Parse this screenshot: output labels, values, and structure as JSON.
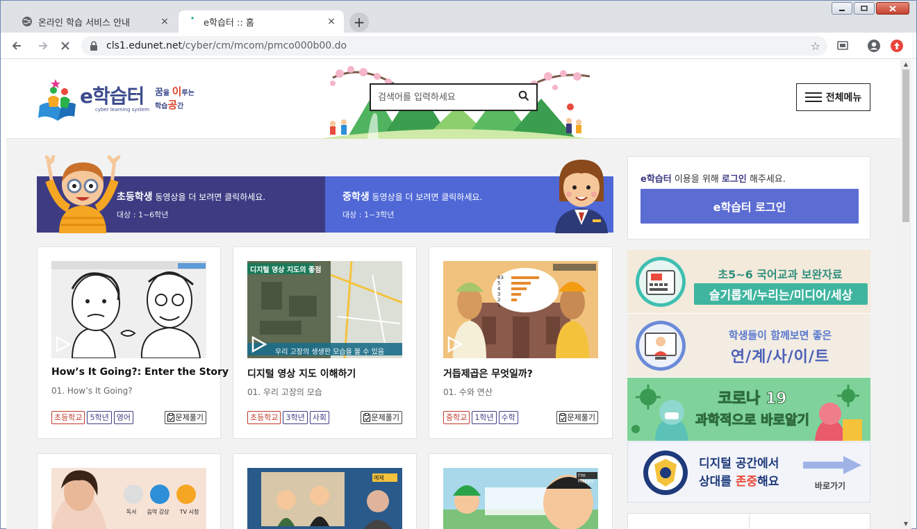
{
  "browser": {
    "tabs": [
      {
        "title": "온라인 학습 서비스 안내",
        "close": "×"
      },
      {
        "title": "e학습터 :: 홈",
        "close": "×"
      }
    ],
    "new_tab": "+",
    "url_host": "cls1.edunet.net",
    "url_path": "/cyber/cm/mcom/pmco000b00.do"
  },
  "header": {
    "logo_main": "e학습터",
    "logo_sub": "cyber learning system",
    "slogan_line1_a": "꿈",
    "slogan_line1_b": "을 ",
    "slogan_line1_c": "이",
    "slogan_line1_d": "루는",
    "slogan_line2_a": "학습",
    "slogan_line2_b": "공",
    "slogan_line2_c": "간",
    "search_placeholder": "검색어를 입력하세요",
    "menu_label": "전체메뉴"
  },
  "banners": [
    {
      "title": "초등학생",
      "title_rest": " 동영상을 더 보려면 클릭하세요.",
      "sub": "대상 : 1~6학년"
    },
    {
      "title": "중학생",
      "title_rest": " 동영상을 더 보려면 클릭하세요.",
      "sub": "대상 : 1~3학년"
    }
  ],
  "login": {
    "msg_a": "e학습터",
    "msg_b": " 이용을 위해 ",
    "msg_c": "로그인",
    "msg_d": " 해주세요.",
    "button": "e학습터 로그인"
  },
  "promos": [
    {
      "line1": "초5~6 국어교과 보완자료",
      "line2": "슬기롭게/누리는/미디어/세상"
    },
    {
      "line1": "학생들이 함께보면 좋은",
      "line2": "연/계/사/이/트"
    },
    {
      "line1": "코로나 19",
      "line2": "과학적으로 바로알기"
    },
    {
      "line1": "디지털 공간에서",
      "line2a": "상대를 ",
      "line2b": "존중",
      "line2c": "해요",
      "link": "바로가기"
    }
  ],
  "cards": [
    {
      "title": "How’s It Going?: Enter the Story",
      "sub": "01. How’s It Going?",
      "school": "초등학교",
      "grade": "5학년",
      "subject": "영어",
      "quiz": "문제풀기",
      "thumb_label": "How's It Going?"
    },
    {
      "title": "디지털 영상 지도 이해하기",
      "sub": "01. 우리 고장의 모습",
      "school": "초등학교",
      "grade": "3학년",
      "subject": "사회",
      "quiz": "문제풀기",
      "thumb_label": "디지털 영상 지도의 좋점",
      "thumb_caption": "우리 고장의 생생한 모습을 볼 수 있음"
    },
    {
      "title": "거듭제곱은 무엇일까?",
      "sub": "01. 수와 연산",
      "school": "중학교",
      "grade": "1학년",
      "subject": "수학",
      "quiz": "문제풀기",
      "thumb_numbers": [
        "63",
        "5",
        "4",
        "3",
        "2",
        "1"
      ]
    }
  ],
  "thumb_row2": [
    {
      "labels": [
        "독서",
        "음악 감상",
        "TV 시청"
      ]
    },
    {
      "label": "예제"
    },
    {
      "label": "I'm Happy"
    }
  ],
  "colors": {
    "banner_elem": "#3d3c83",
    "banner_mid": "#4f68d6",
    "login_button": "#5b6cd3",
    "tag_school": "#c0392b",
    "tag_grade": "#3d3c83"
  }
}
